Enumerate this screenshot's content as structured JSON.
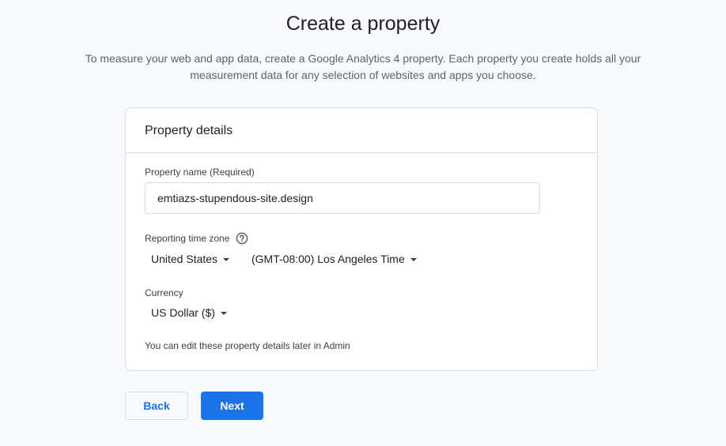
{
  "page": {
    "title": "Create a property",
    "description": "To measure your web and app data, create a Google Analytics 4 property. Each property you create holds all your measurement data for any selection of websites and apps you choose."
  },
  "card": {
    "title": "Property details",
    "property_name": {
      "label": "Property name (Required)",
      "value": "emtiazs-stupendous-site.design"
    },
    "time_zone": {
      "label": "Reporting time zone",
      "help_icon": "help-circle-icon",
      "country": "United States",
      "zone": "(GMT-08:00) Los Angeles Time"
    },
    "currency": {
      "label": "Currency",
      "value": "US Dollar ($)"
    },
    "hint": "You can edit these property details later in Admin"
  },
  "buttons": {
    "back_label": "Back",
    "next_label": "Next"
  },
  "colors": {
    "accent": "#1a73e8",
    "background": "#f8f9fa",
    "border": "#dadce0"
  }
}
